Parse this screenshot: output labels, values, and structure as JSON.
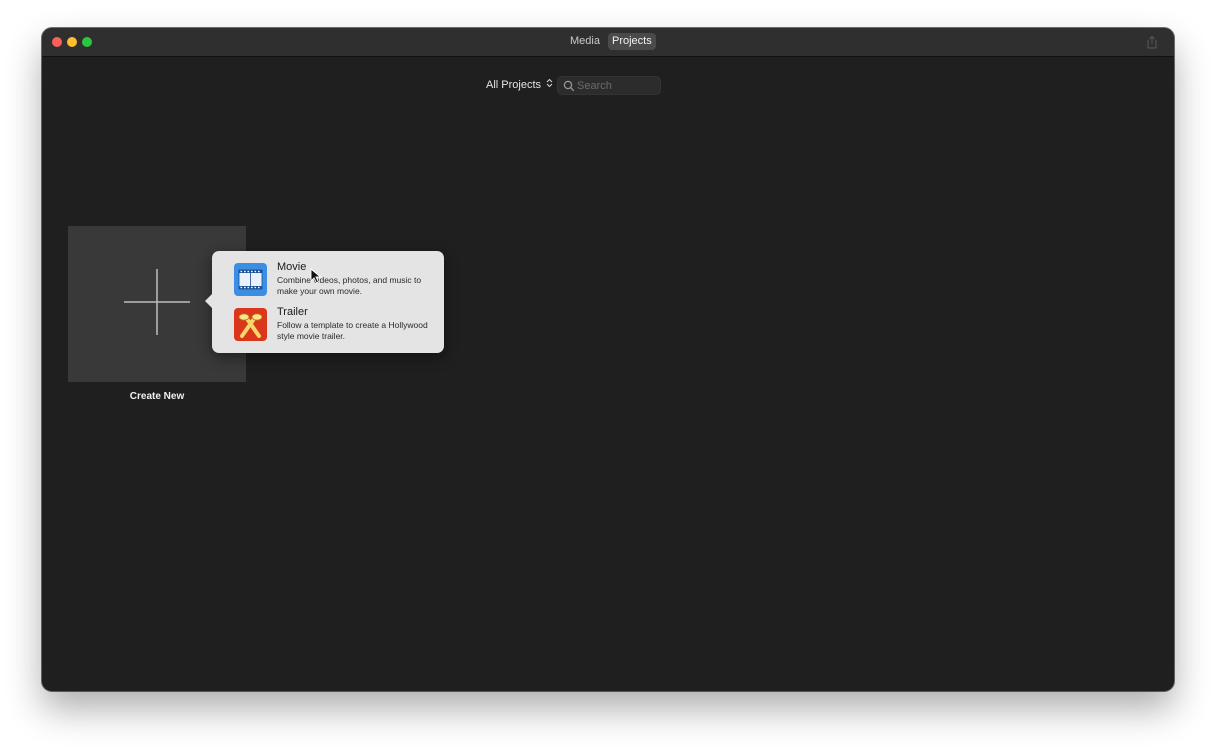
{
  "titlebar": {
    "tabs": [
      {
        "label": "Media"
      },
      {
        "label": "Projects",
        "selected": true
      }
    ],
    "share_icon": "share-icon"
  },
  "toolbar": {
    "filter_label": "All Projects",
    "filter_icon": "up-down-chevron-icon",
    "search_placeholder": "Search",
    "search_value": ""
  },
  "create_new": {
    "label": "Create New",
    "icon": "plus-icon"
  },
  "popover": {
    "options": [
      {
        "title": "Movie",
        "description": "Combine videos, photos, and music to make your own movie.",
        "icon": "movie-film-icon",
        "icon_color": "#3a8ee6"
      },
      {
        "title": "Trailer",
        "description": "Follow a template to create a Hollywood style movie trailer.",
        "icon": "trailer-spotlight-icon",
        "icon_color": "#d9361c"
      }
    ]
  },
  "colors": {
    "window_bg": "#1f1f1f",
    "titlebar_bg": "#2f2f2f",
    "close": "#ff5f57",
    "minimize": "#febc2e",
    "maximize": "#28c840",
    "popover_bg": "#e4e4e4"
  }
}
